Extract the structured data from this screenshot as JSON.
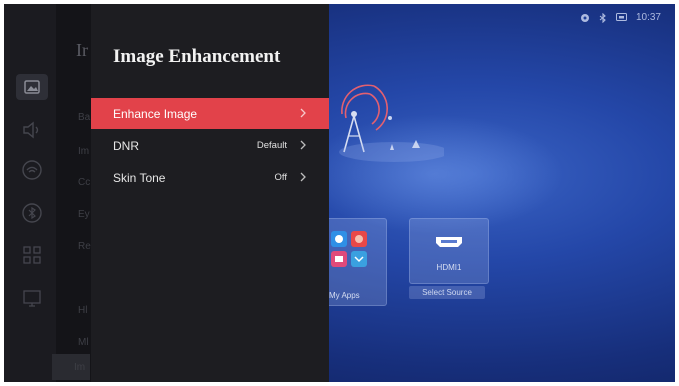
{
  "status_bar": {
    "time": "10:37",
    "icons": [
      "settings-gear-icon",
      "bluetooth-icon",
      "input-source-icon"
    ]
  },
  "home": {
    "apps_tile": {
      "label": "My Apps"
    },
    "hdmi_tile": {
      "label": "HDMI1",
      "button": "Select Source"
    }
  },
  "background_menu": {
    "title_fragment": "Ir",
    "items": [
      "Ba",
      "Im",
      "Cc",
      "Ey",
      "Re",
      "Hl",
      "Ml",
      "Im"
    ]
  },
  "sidebar": {
    "icons": [
      "picture-icon",
      "sound-icon",
      "network-icon",
      "bluetooth-icon",
      "apps-grid-icon",
      "cast-icon"
    ],
    "active": "picture-icon"
  },
  "panel": {
    "title": "Image Enhancement",
    "items": [
      {
        "label": "Enhance Image",
        "value": "",
        "selected": true
      },
      {
        "label": "DNR",
        "value": "Default",
        "selected": false
      },
      {
        "label": "Skin Tone",
        "value": "Off",
        "selected": false
      }
    ]
  },
  "colors": {
    "accent": "#e2424a",
    "panel": "#1d1d21",
    "background": "#1f3f99"
  }
}
